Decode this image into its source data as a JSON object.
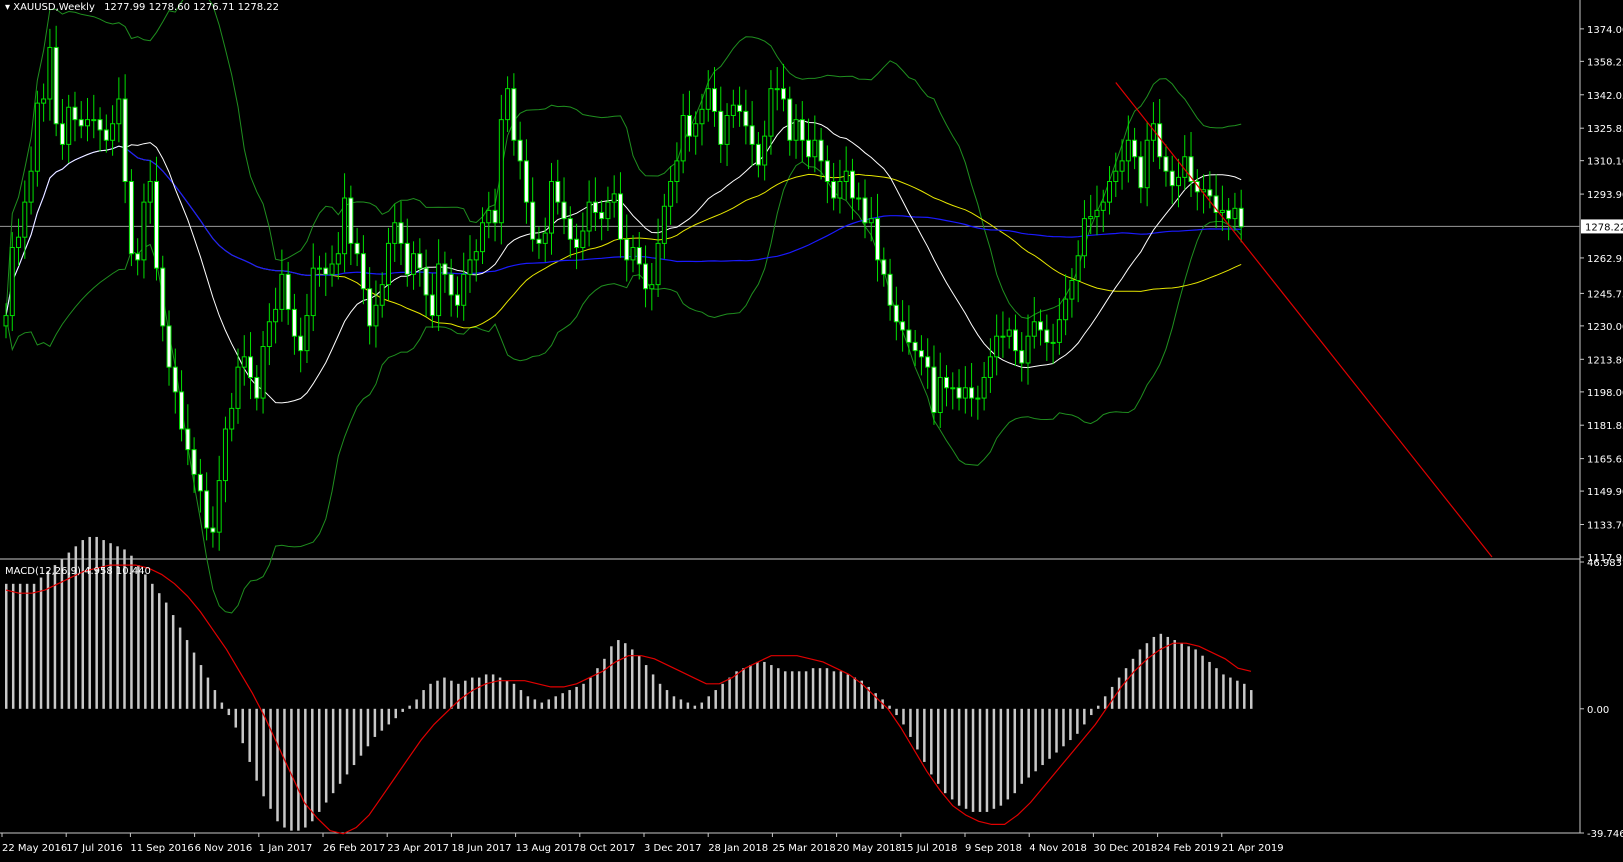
{
  "chart_data": {
    "type": "candlestick",
    "symbol": "XAUUSD",
    "timeframe": "Weekly",
    "header": {
      "title": "XAUUSD,Weekly",
      "ohlc": "1277.99 1278.60 1276.71 1278.22"
    },
    "current_price_label": "1278.22",
    "price_axis": {
      "min": 1117.95,
      "max": 1388.0,
      "ticks": [
        "1374.00",
        "1358.25",
        "1342.05",
        "1325.85",
        "1310.10",
        "1293.90",
        "1262.95",
        "1245.75",
        "1230.00",
        "1213.80",
        "1198.00",
        "1181.85",
        "1165.65",
        "1149.90",
        "1133.70",
        "1117.95"
      ]
    },
    "x_axis_labels": [
      "22 May 2016",
      "17 Jul 2016",
      "11 Sep 2016",
      "6 Nov 2016",
      "1 Jan 2017",
      "26 Feb 2017",
      "23 Apr 2017",
      "18 Jun 2017",
      "13 Aug 2017",
      "8 Oct 2017",
      "3 Dec 2017",
      "28 Jan 2018",
      "25 Mar 2018",
      "20 May 2018",
      "15 Jul 2018",
      "9 Sep 2018",
      "4 Nov 2018",
      "30 Dec 2018",
      "24 Feb 2019",
      "21 Apr 2019"
    ],
    "closes": [
      1235,
      1268,
      1273,
      1290,
      1305,
      1338,
      1340,
      1365,
      1328,
      1318,
      1336,
      1330,
      1327,
      1330,
      1330,
      1325,
      1320,
      1328,
      1340,
      1300,
      1265,
      1262,
      1290,
      1300,
      1258,
      1230,
      1210,
      1198,
      1180,
      1170,
      1158,
      1150,
      1132,
      1130,
      1155,
      1180,
      1190,
      1210,
      1215,
      1205,
      1195,
      1220,
      1232,
      1238,
      1255,
      1238,
      1225,
      1218,
      1235,
      1258,
      1258,
      1255,
      1260,
      1265,
      1292,
      1270,
      1265,
      1248,
      1230,
      1240,
      1250,
      1270,
      1280,
      1270,
      1255,
      1265,
      1258,
      1245,
      1235,
      1260,
      1255,
      1245,
      1240,
      1255,
      1262,
      1266,
      1280,
      1286,
      1280,
      1330,
      1345,
      1320,
      1310,
      1290,
      1272,
      1270,
      1275,
      1300,
      1290,
      1282,
      1272,
      1268,
      1276,
      1290,
      1285,
      1282,
      1290,
      1294,
      1272,
      1262,
      1268,
      1260,
      1248,
      1250,
      1270,
      1288,
      1300,
      1310,
      1332,
      1322,
      1328,
      1335,
      1345,
      1334,
      1318,
      1332,
      1337,
      1334,
      1327,
      1318,
      1308,
      1322,
      1345,
      1345,
      1340,
      1320,
      1330,
      1320,
      1312,
      1320,
      1310,
      1300,
      1292,
      1300,
      1305,
      1292,
      1292,
      1280,
      1282,
      1262,
      1255,
      1240,
      1232,
      1228,
      1222,
      1218,
      1215,
      1210,
      1188,
      1205,
      1200,
      1200,
      1195,
      1200,
      1195,
      1195,
      1205,
      1215,
      1225,
      1225,
      1228,
      1218,
      1212,
      1225,
      1232,
      1228,
      1222,
      1222,
      1233,
      1243,
      1252,
      1264,
      1282,
      1283,
      1286,
      1290,
      1300,
      1305,
      1310,
      1320,
      1312,
      1297,
      1320,
      1328,
      1312,
      1305,
      1298,
      1302,
      1312,
      1300,
      1295,
      1296,
      1293,
      1285,
      1286,
      1282,
      1287,
      1278
    ],
    "indicators": [
      "Bollinger Bands",
      "Moving Average (fast)",
      "Moving Average (slow)",
      "Moving Average (long)"
    ],
    "trendline": {
      "from": 1348,
      "to": 1117.95
    },
    "macd": {
      "label": "MACD(12,26,9) 4.958 10.440",
      "scale_max": "46.983",
      "scale_zero": "0.00",
      "scale_min": "-39.746",
      "histogram": [
        40,
        40,
        40,
        40,
        40,
        42,
        44,
        46,
        48,
        50,
        52,
        54,
        55,
        55,
        54,
        53,
        52,
        51,
        49,
        46,
        43,
        40,
        37,
        34,
        30,
        26,
        22,
        18,
        14,
        10,
        6,
        2,
        -2,
        -6,
        -11,
        -17,
        -23,
        -28,
        -32,
        -36,
        -38,
        -39,
        -39,
        -38,
        -36,
        -33,
        -30,
        -27,
        -24,
        -21,
        -18,
        -15,
        -12,
        -9,
        -7,
        -5,
        -3,
        -1,
        1,
        3,
        6,
        8,
        9,
        10,
        9,
        8,
        9,
        10,
        10,
        11,
        11,
        10,
        9,
        8,
        6,
        4,
        3,
        2,
        3,
        4,
        5,
        6,
        7,
        8,
        10,
        13,
        16,
        20,
        22,
        21,
        19,
        17,
        14,
        11,
        8,
        6,
        4,
        3,
        2,
        1,
        2,
        4,
        6,
        8,
        10,
        12,
        13,
        14,
        15,
        15,
        14,
        13,
        12,
        12,
        12,
        12,
        13,
        13,
        13,
        12,
        12,
        11,
        10,
        9,
        7,
        5,
        3,
        1,
        -2,
        -5,
        -9,
        -13,
        -17,
        -21,
        -24,
        -27,
        -29,
        -31,
        -32,
        -33,
        -33,
        -33,
        -32,
        -31,
        -29,
        -27,
        -24,
        -22,
        -20,
        -18,
        -16,
        -14,
        -12,
        -10,
        -8,
        -5,
        -2,
        1,
        4,
        7,
        10,
        13,
        16,
        19,
        21,
        23,
        24,
        23,
        22,
        21,
        20,
        19,
        17,
        15,
        13,
        11,
        10,
        9,
        8,
        6
      ],
      "signal": [
        38,
        37,
        37,
        38,
        40,
        42,
        44,
        45,
        46,
        46,
        46,
        45,
        43,
        40,
        36,
        31,
        25,
        19,
        12,
        5,
        -3,
        -12,
        -21,
        -30,
        -35,
        -39,
        -40,
        -38,
        -34,
        -28,
        -22,
        -16,
        -10,
        -5,
        -1,
        3,
        6,
        8,
        9,
        9,
        9,
        8,
        7,
        7,
        8,
        10,
        12,
        15,
        17,
        17,
        16,
        14,
        12,
        10,
        8,
        8,
        10,
        13,
        15,
        17,
        17,
        17,
        16,
        15,
        13,
        11,
        8,
        4,
        0,
        -6,
        -13,
        -20,
        -26,
        -31,
        -34,
        -36,
        -37,
        -37,
        -34,
        -30,
        -25,
        -20,
        -15,
        -10,
        -5,
        1,
        7,
        12,
        16,
        19,
        21,
        21,
        20,
        18,
        16,
        13,
        12
      ]
    }
  }
}
